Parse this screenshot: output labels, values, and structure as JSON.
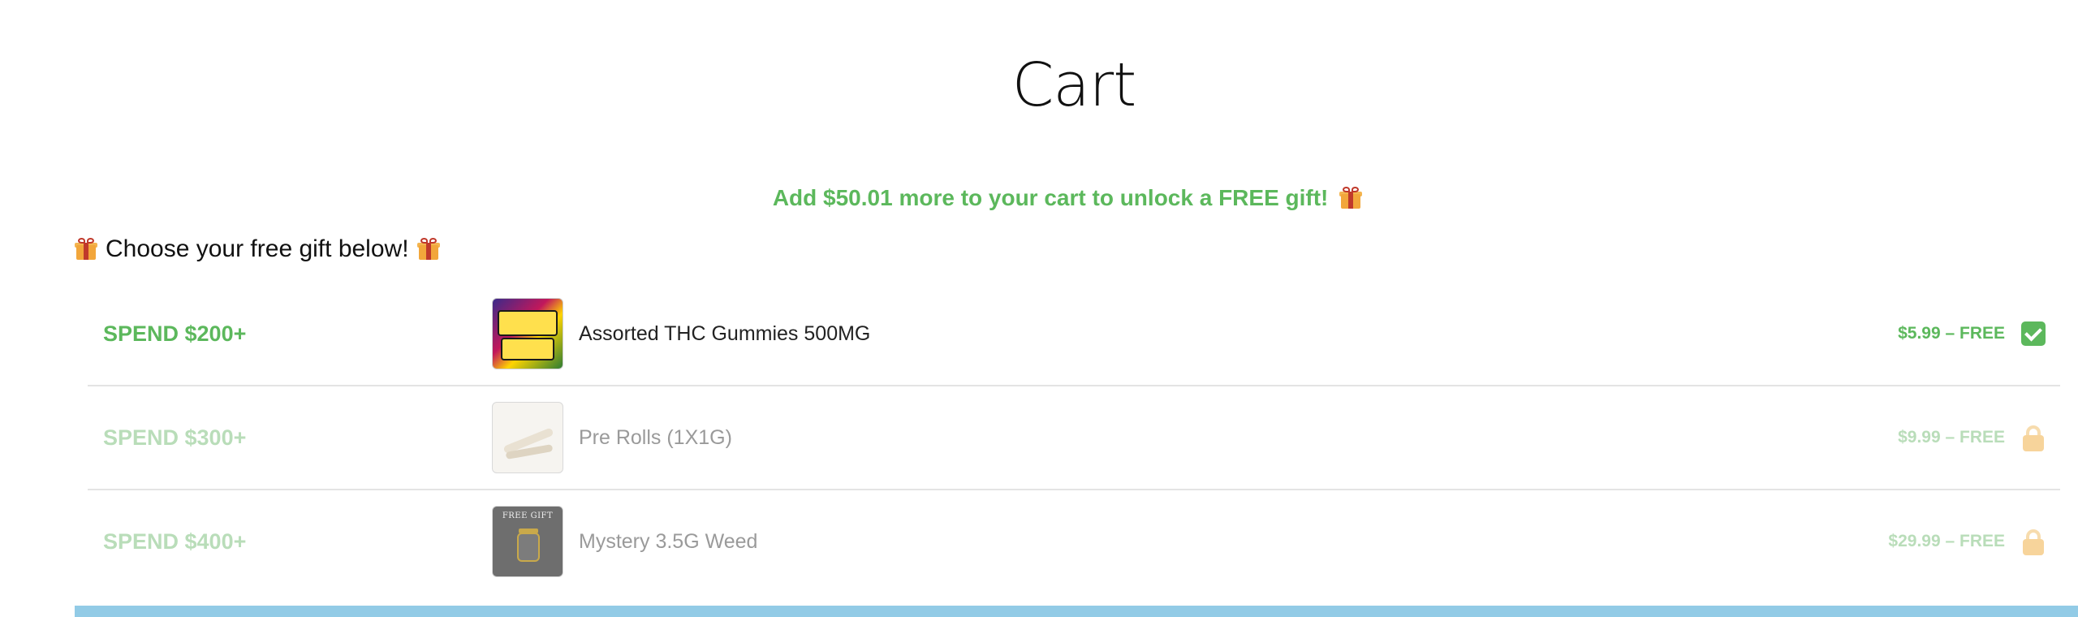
{
  "page": {
    "title": "Cart"
  },
  "promo": {
    "unlock_message": "Add $50.01 more to your cart to unlock a FREE gift!",
    "choose_message": "Choose your free gift below!",
    "accent_color": "#5cb85c"
  },
  "gift_tiers": [
    {
      "label": "SPEND $200+",
      "product_name": "Assorted THC Gummies 500MG",
      "price_text": "$5.99 – FREE",
      "status": "unlocked",
      "status_icon": "check-icon"
    },
    {
      "label": "SPEND $300+",
      "product_name": "Pre Rolls (1X1G)",
      "price_text": "$9.99 – FREE",
      "status": "locked",
      "status_icon": "lock-icon"
    },
    {
      "label": "SPEND $400+",
      "product_name": "Mystery 3.5G Weed",
      "price_text": "$29.99 – FREE",
      "status": "locked",
      "status_icon": "lock-icon",
      "thumb_caption": "FREE GIFT"
    }
  ],
  "colors": {
    "unlocked_green": "#5cb85c",
    "locked_green": "#b9ddb9",
    "lock_color": "#f7d49b",
    "bottom_bar": "#92cbe6"
  }
}
